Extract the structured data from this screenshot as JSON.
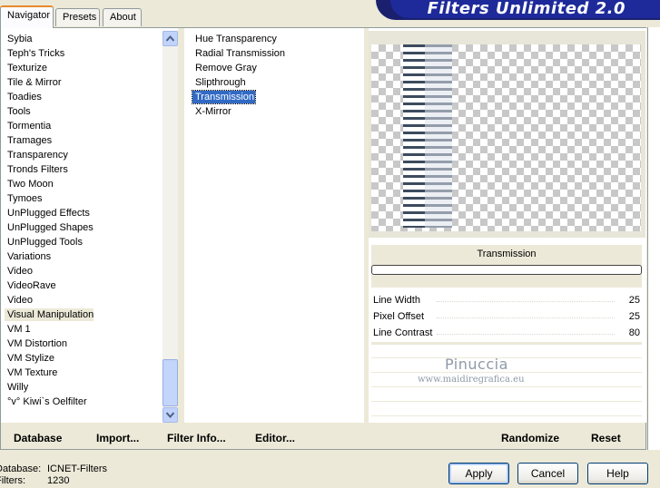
{
  "tabs": [
    {
      "label": "Navigator",
      "active": true
    },
    {
      "label": "Presets",
      "active": false
    },
    {
      "label": "About",
      "active": false
    }
  ],
  "banner_title": "Filters Unlimited 2.0",
  "categories": [
    {
      "label": "Sybia"
    },
    {
      "label": "Teph's Tricks"
    },
    {
      "label": "Texturize"
    },
    {
      "label": "Tile & Mirror"
    },
    {
      "label": "Toadies"
    },
    {
      "label": "Tools"
    },
    {
      "label": "Tormentia"
    },
    {
      "label": "Tramages"
    },
    {
      "label": "Transparency"
    },
    {
      "label": "Tronds Filters"
    },
    {
      "label": "Two Moon"
    },
    {
      "label": "Tymoes"
    },
    {
      "label": "UnPlugged Effects"
    },
    {
      "label": "UnPlugged Shapes"
    },
    {
      "label": "UnPlugged Tools"
    },
    {
      "label": "Variations"
    },
    {
      "label": "Video"
    },
    {
      "label": "VideoRave"
    },
    {
      "label": "Video"
    },
    {
      "label": "Visual Manipulation",
      "highlighted": true
    },
    {
      "label": "VM 1"
    },
    {
      "label": "VM Distortion"
    },
    {
      "label": "VM Stylize"
    },
    {
      "label": "VM Texture"
    },
    {
      "label": "Willy"
    },
    {
      "label": "°v° Kiwi`s Oelfilter"
    }
  ],
  "filters": [
    {
      "label": "Hue Transparency"
    },
    {
      "label": "Radial Transmission"
    },
    {
      "label": "Remove Gray"
    },
    {
      "label": "Slipthrough"
    },
    {
      "label": "Transmission",
      "selected": true
    },
    {
      "label": "X-Mirror"
    }
  ],
  "filter_name": "Transmission",
  "parameters": [
    {
      "label": "Line Width",
      "value": "25"
    },
    {
      "label": "Pixel Offset",
      "value": "25"
    },
    {
      "label": "Line Contrast",
      "value": "80"
    }
  ],
  "watermark": {
    "name": "Pinuccia",
    "url": "www.maidiregrafica.eu"
  },
  "toolbar": {
    "database": "Database",
    "import": "Import...",
    "filter_info": "Filter Info...",
    "editor": "Editor...",
    "randomize": "Randomize",
    "reset": "Reset"
  },
  "info": {
    "database_label": "Database:",
    "database_value": "ICNET-Filters",
    "filters_label": "Filters:",
    "filters_value": "1230"
  },
  "buttons": {
    "apply": "Apply",
    "cancel": "Cancel",
    "help": "Help"
  }
}
